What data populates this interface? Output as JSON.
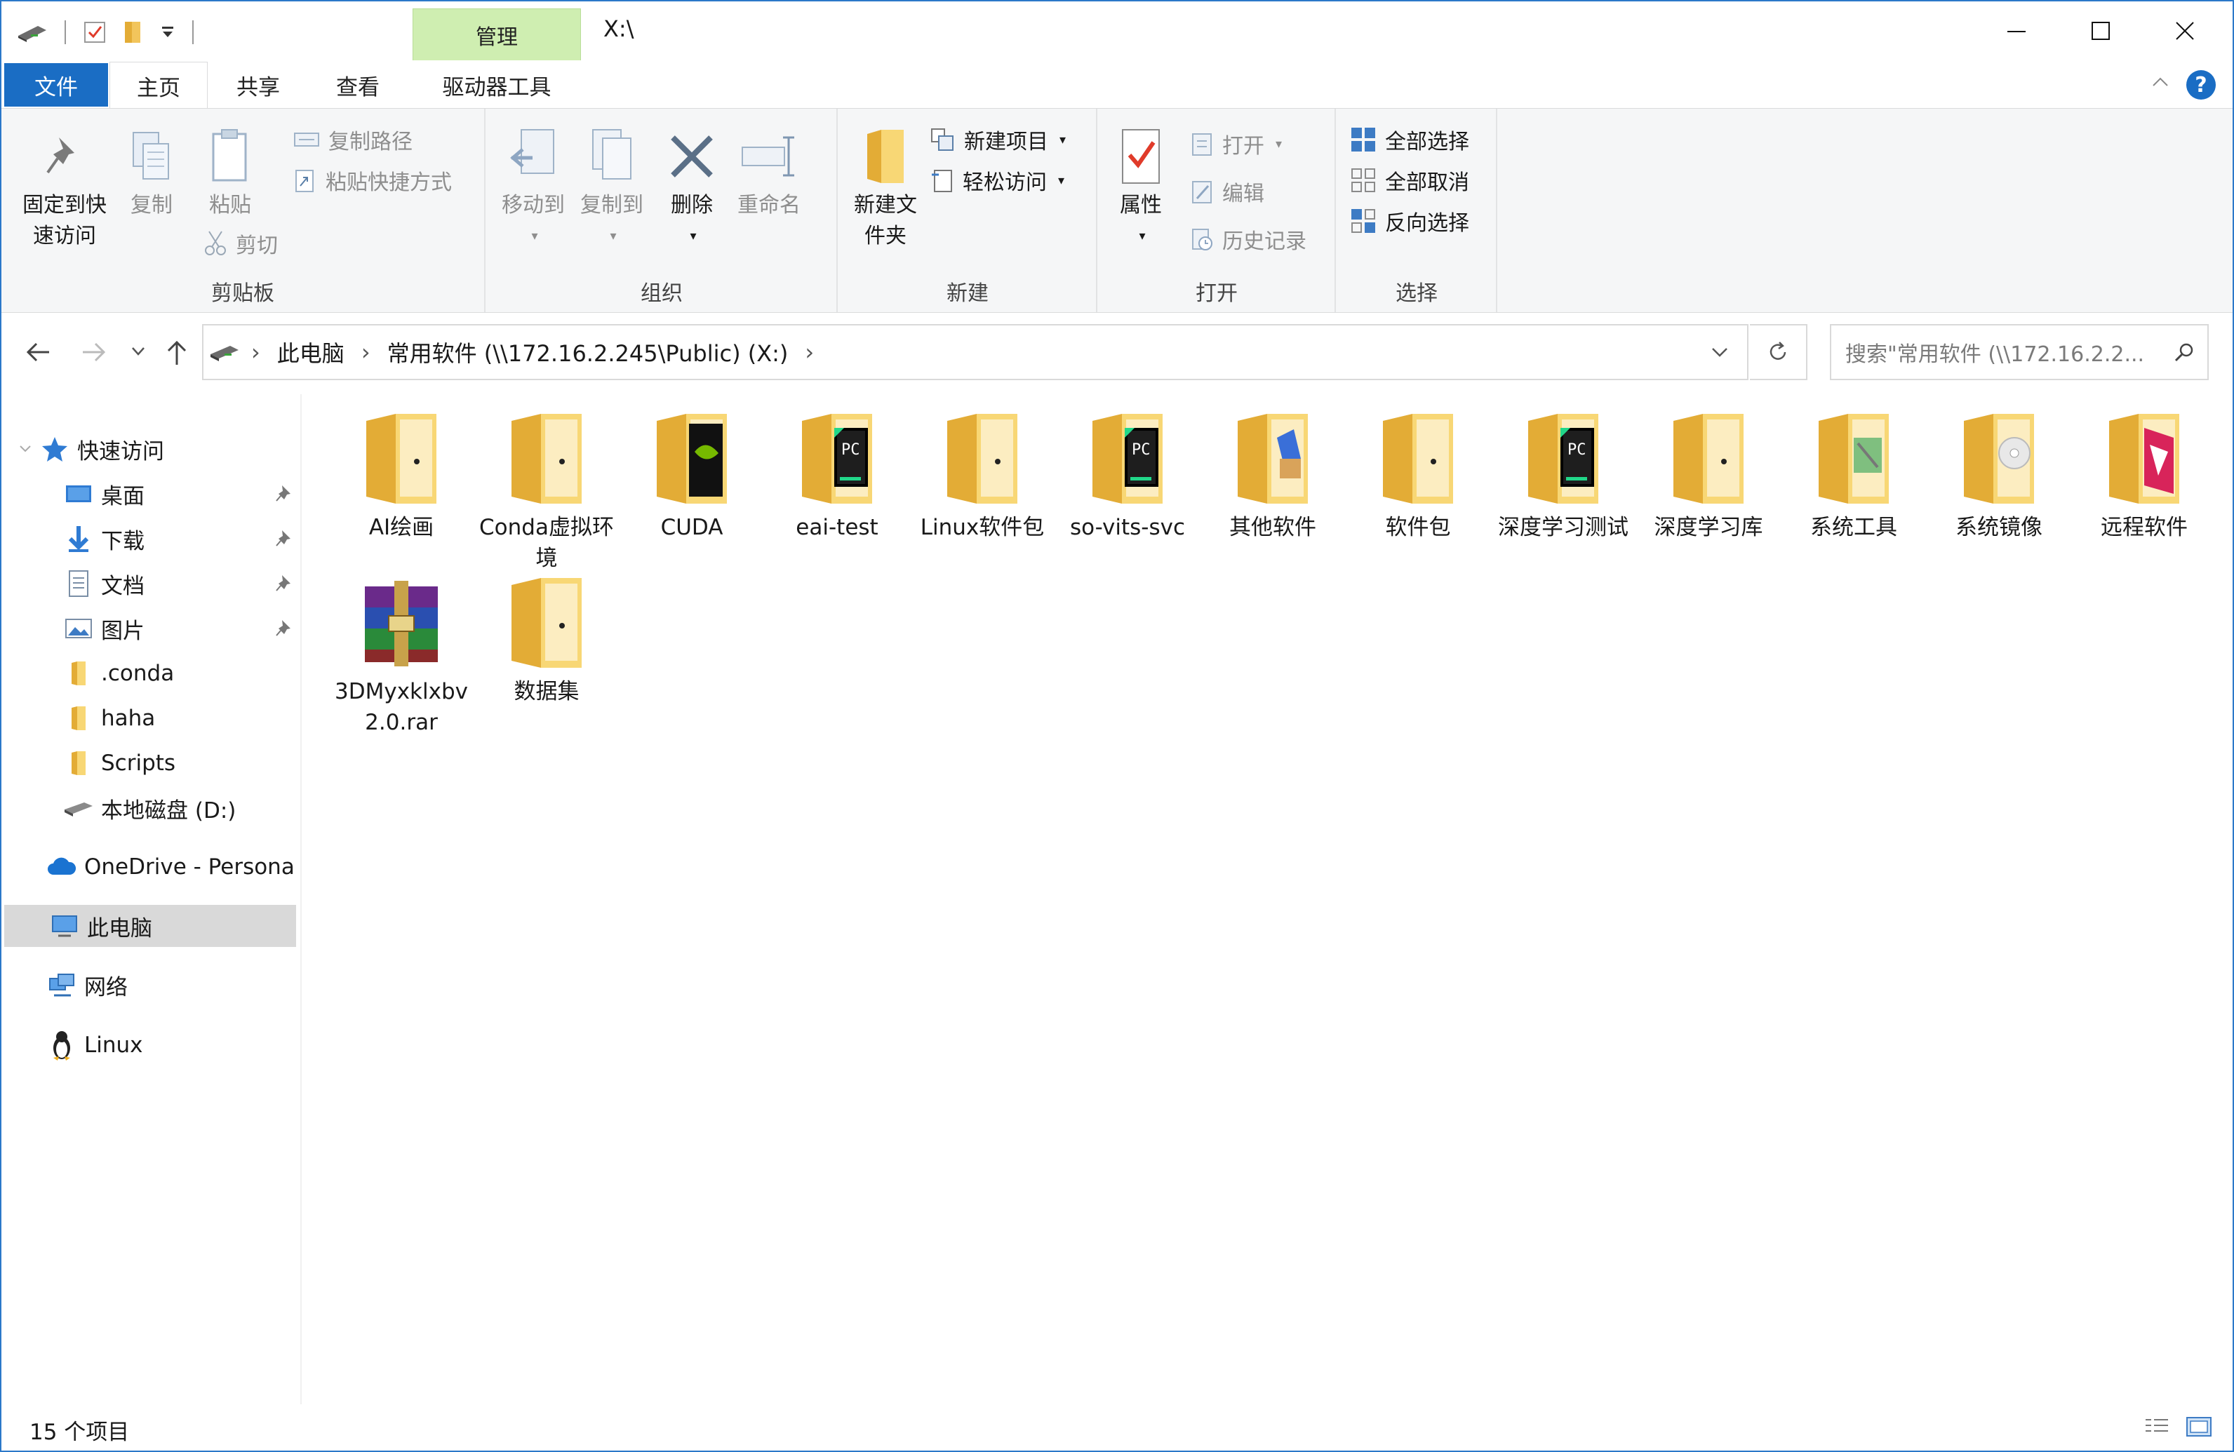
{
  "window": {
    "title": "X:\\",
    "context_tab": "管理"
  },
  "tabs": {
    "file": "文件",
    "home": "主页",
    "share": "共享",
    "view": "查看",
    "drive_tools": "驱动器工具"
  },
  "ribbon": {
    "clipboard": {
      "pin": "固定到快速访问",
      "copy": "复制",
      "paste": "粘贴",
      "copy_path": "复制路径",
      "paste_shortcut": "粘贴快捷方式",
      "cut": "剪切",
      "label": "剪贴板"
    },
    "organize": {
      "move_to": "移动到",
      "copy_to": "复制到",
      "delete": "删除",
      "rename": "重命名",
      "label": "组织"
    },
    "new": {
      "new_folder": "新建文件夹",
      "new_item": "新建项目",
      "easy_access": "轻松访问",
      "label": "新建"
    },
    "open": {
      "properties": "属性",
      "open": "打开",
      "edit": "编辑",
      "history": "历史记录",
      "label": "打开"
    },
    "select": {
      "select_all": "全部选择",
      "select_none": "全部取消",
      "invert": "反向选择",
      "label": "选择"
    }
  },
  "address": {
    "segments": [
      "此电脑",
      "常用软件 (\\\\172.16.2.245\\Public) (X:)"
    ]
  },
  "search": {
    "placeholder": "搜索\"常用软件 (\\\\172.16.2.2..."
  },
  "nav": {
    "quick_access": "快速访问",
    "desktop": "桌面",
    "downloads": "下载",
    "documents": "文档",
    "pictures": "图片",
    "conda": ".conda",
    "haha": "haha",
    "scripts": "Scripts",
    "local_disk": "本地磁盘 (D:)",
    "onedrive": "OneDrive - Persona",
    "this_pc": "此电脑",
    "network": "网络",
    "linux": "Linux"
  },
  "files": [
    {
      "name": "AI绘画",
      "type": "folder"
    },
    {
      "name": "Conda虚拟环境",
      "type": "folder"
    },
    {
      "name": "CUDA",
      "type": "folder-cuda"
    },
    {
      "name": "eai-test",
      "type": "folder-pycharm"
    },
    {
      "name": "Linux软件包",
      "type": "folder"
    },
    {
      "name": "so-vits-svc",
      "type": "folder-pycharm"
    },
    {
      "name": "其他软件",
      "type": "folder-box"
    },
    {
      "name": "软件包",
      "type": "folder"
    },
    {
      "name": "深度学习测试",
      "type": "folder-pycharm"
    },
    {
      "name": "深度学习库",
      "type": "folder"
    },
    {
      "name": "系统工具",
      "type": "folder-tools"
    },
    {
      "name": "系统镜像",
      "type": "folder-disc"
    },
    {
      "name": "远程软件",
      "type": "folder-remote"
    },
    {
      "name": "3DMyxklxbv2.0.rar",
      "type": "rar"
    },
    {
      "name": "数据集",
      "type": "folder"
    }
  ],
  "status": {
    "count": "15 个项目"
  },
  "colors": {
    "accent": "#1a6dc4",
    "context_tab": "#cfeeb1",
    "folder": "#f8d775",
    "selected": "#d9d9d9"
  }
}
